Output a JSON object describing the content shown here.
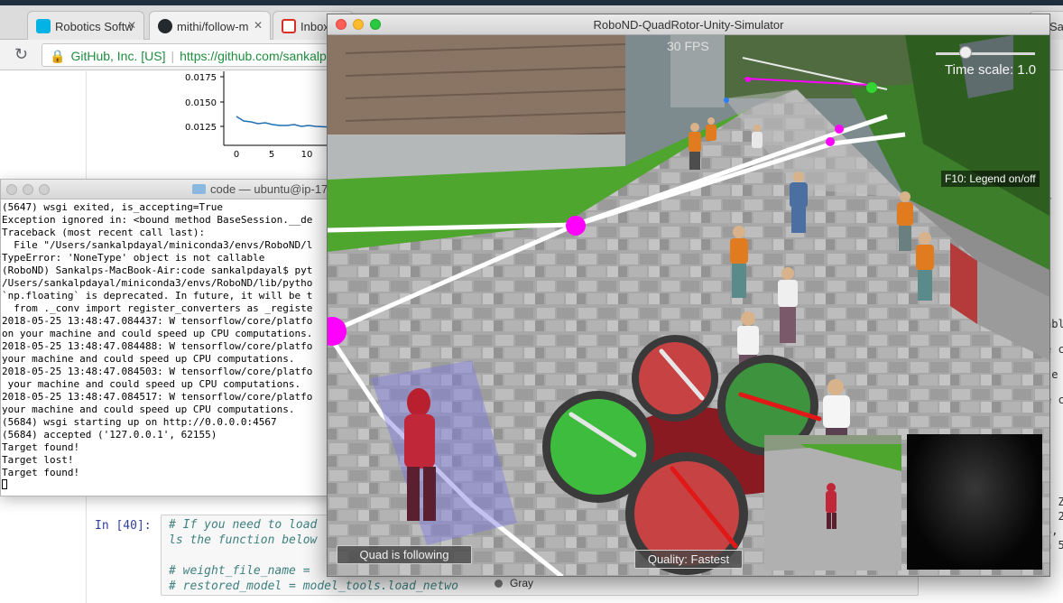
{
  "browser": {
    "tabs": [
      {
        "label": "Robotics Softw",
        "icon": "udacity-icon"
      },
      {
        "label": "mithi/follow-m",
        "icon": "github-icon"
      },
      {
        "label": "Inbox",
        "icon": "gmail-icon"
      }
    ],
    "right_tab": "Sa",
    "address": {
      "secure_label": "GitHub, Inc. [US]",
      "url": "https://github.com/sankalp"
    }
  },
  "notebook": {
    "chart": {
      "yticks": [
        "0.0175",
        "0.0150",
        "0.0125"
      ],
      "xticks": [
        "0",
        "5",
        "10"
      ]
    },
    "cell": {
      "prompt": "In [40]:",
      "lines": [
        "# If you need to load",
        "ls the function below",
        "",
        "# weight_file_name =",
        "# restored_model = model_tools.load_netwo"
      ]
    },
    "gray_item": "Gray",
    "right_fragments": [
      {
        "top": 215,
        "text": "r"
      },
      {
        "top": 308,
        "text": "t"
      },
      {
        "top": 352,
        "text": "abl"
      },
      {
        "top": 380,
        "text": "e c"
      },
      {
        "top": 408,
        "text": "le"
      },
      {
        "top": 436,
        "text": "e c"
      },
      {
        "top": 549,
        "text": ", Z"
      },
      {
        "top": 565,
        "text": ", 2"
      },
      {
        "top": 581,
        "text": "3, 1"
      },
      {
        "top": 597,
        "text": "n 5"
      }
    ]
  },
  "terminal": {
    "title": "code — ubuntu@ip-17",
    "lines": [
      "(5647) wsgi exited, is_accepting=True",
      "Exception ignored in: <bound method BaseSession.__de",
      "Traceback (most recent call last):",
      "  File \"/Users/sankalpdayal/miniconda3/envs/RoboND/l",
      "TypeError: 'NoneType' object is not callable",
      "(RoboND) Sankalps-MacBook-Air:code sankalpdayal$ pyt",
      "/Users/sankalpdayal/miniconda3/envs/RoboND/lib/pytho",
      "`np.floating` is deprecated. In future, it will be t",
      "  from ._conv import register_converters as _registe",
      "2018-05-25 13:48:47.084437: W tensorflow/core/platfo",
      "on your machine and could speed up CPU computations.",
      "2018-05-25 13:48:47.084488: W tensorflow/core/platfo",
      "your machine and could speed up CPU computations.",
      "2018-05-25 13:48:47.084503: W tensorflow/core/platfo",
      " your machine and could speed up CPU computations.",
      "2018-05-25 13:48:47.084517: W tensorflow/core/platfo",
      "your machine and could speed up CPU computations.",
      "(5684) wsgi starting up on http://0.0.0.0:4567",
      "(5684) accepted ('127.0.0.1', 62155)",
      "Target found!",
      "Target lost!",
      "Target found!"
    ]
  },
  "simulator": {
    "title": "RoboND-QuadRotor-Unity-Simulator",
    "fps": "30 FPS",
    "time_scale": "Time scale: 1.0",
    "time_scale_value": 0.3,
    "legend_hint": "F10: Legend on/off",
    "follow_status": "Quad is following",
    "quality": "Quality: Fastest",
    "colors": {
      "waypoint": "#ff00ff",
      "rotor_green": "#3fd33f",
      "rotor_red": "#e04545",
      "grass": "#4fa62e"
    }
  }
}
